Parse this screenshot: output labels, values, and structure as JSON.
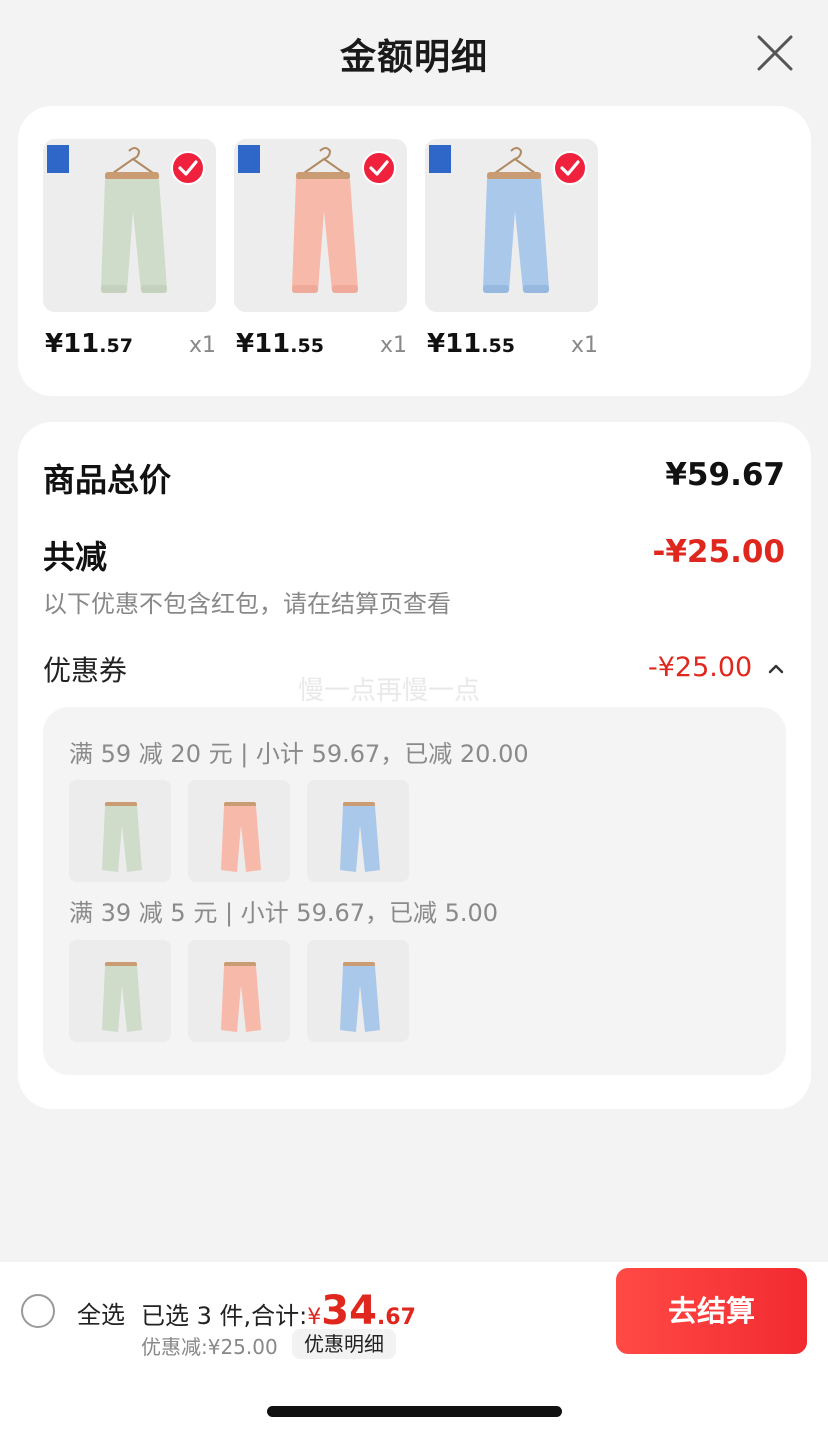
{
  "header": {
    "title": "金额明细",
    "close_icon": "close-icon"
  },
  "products": [
    {
      "price_int": "¥11",
      "price_dec": ".57",
      "qty": "x1",
      "color": "#cfdcca",
      "selected": true
    },
    {
      "price_int": "¥11",
      "price_dec": ".55",
      "qty": "x1",
      "color": "#f7b9aa",
      "selected": true
    },
    {
      "price_int": "¥11",
      "price_dec": ".55",
      "qty": "x1",
      "color": "#a9c8ea",
      "selected": true
    }
  ],
  "summary": {
    "total_label": "商品总价",
    "total_value": "¥59.67",
    "reduce_label": "共减",
    "reduce_value": "-¥25.00",
    "note": "以下优惠不包含红包，请在结算页查看",
    "coupon_label": "优惠券",
    "coupon_value": "-¥25.00",
    "watermark": "慢一点再慢一点",
    "rules": [
      {
        "text": "满 59 减 20 元 | 小计 59.67，已减 20.00"
      },
      {
        "text": "满 39 减 5 元 | 小计 59.67，已减 5.00"
      }
    ]
  },
  "bottom": {
    "select_all": "全选",
    "selected_text": "已选 3 件,合计:",
    "total_yen": "¥",
    "total_int": "34",
    "total_dec": ".67",
    "discount_text": "优惠减:¥25.00",
    "detail_link": "优惠明细",
    "checkout": "去结算"
  },
  "colors": {
    "accent": "#e0271e",
    "checkout": "#f22a30"
  }
}
